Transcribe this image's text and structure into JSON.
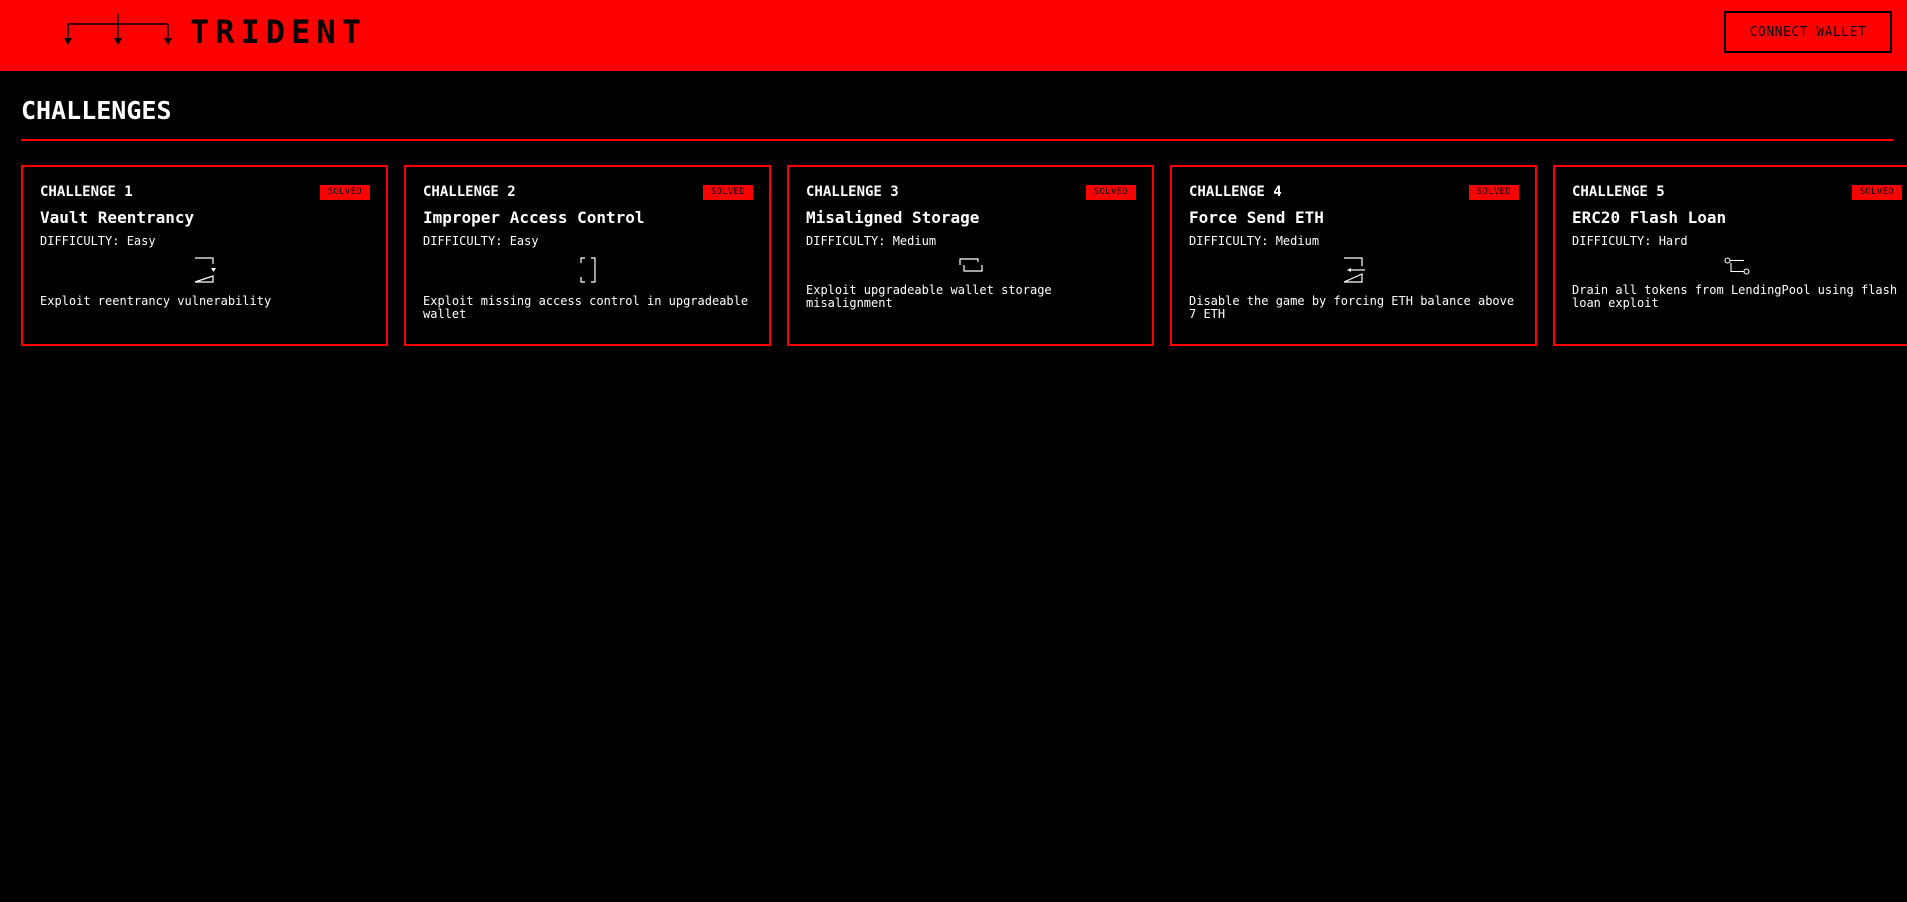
{
  "header": {
    "brand": "TRIDENT",
    "logo_icon": "trident-branch-icon",
    "connect_label": "CONNECT WALLET"
  },
  "main": {
    "section_title": "CHALLENGES"
  },
  "challenges": [
    {
      "number": "CHALLENGE 1",
      "badge": "SOLVED",
      "title": "Vault Reentrancy",
      "difficulty": "DIFFICULTY: Easy",
      "icon": "door-enter-icon",
      "description": "Exploit reentrancy vulnerability"
    },
    {
      "number": "CHALLENGE 2",
      "badge": "SOLVED",
      "title": "Improper Access Control",
      "difficulty": "DIFFICULTY: Easy",
      "icon": "brackets-icon",
      "description": "Exploit missing access control in upgradeable wallet"
    },
    {
      "number": "CHALLENGE 3",
      "badge": "SOLVED",
      "title": "Misaligned Storage",
      "difficulty": "DIFFICULTY: Medium",
      "icon": "misaligned-blocks-icon",
      "description": "Exploit upgradeable wallet storage misalignment"
    },
    {
      "number": "CHALLENGE 4",
      "badge": "SOLVED",
      "title": "Force Send ETH",
      "difficulty": "DIFFICULTY: Medium",
      "icon": "door-push-icon",
      "description": "Disable the game by forcing ETH balance above 7 ETH"
    },
    {
      "number": "CHALLENGE 5",
      "badge": "SOLVED",
      "title": "ERC20 Flash Loan",
      "difficulty": "DIFFICULTY: Hard",
      "icon": "flash-loan-icon",
      "description": "Drain all tokens from LendingPool using flash loan exploit"
    }
  ]
}
